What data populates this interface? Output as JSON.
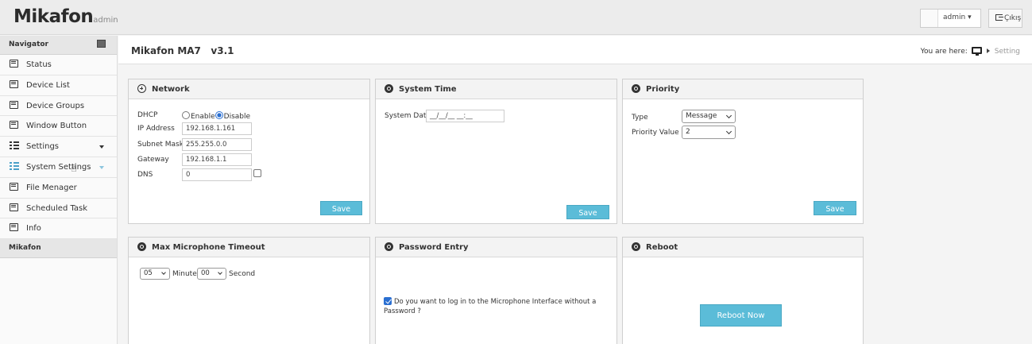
{
  "header": {
    "logo": "Mikafon",
    "logo_sub": "admin",
    "user_name": "admin",
    "exit_label": "Çıkış"
  },
  "sidebar": {
    "heading": "Navigator",
    "items": [
      {
        "label": "Status",
        "icon": "document-icon"
      },
      {
        "label": "Device List",
        "icon": "document-icon"
      },
      {
        "label": "Device Groups",
        "icon": "document-icon"
      },
      {
        "label": "Window Button",
        "icon": "document-icon"
      },
      {
        "label": "Settings",
        "icon": "list-icon"
      },
      {
        "label": "System Settings",
        "icon": "list-icon"
      },
      {
        "label": "File Menager",
        "icon": "document-icon"
      },
      {
        "label": "Scheduled Task",
        "icon": "document-icon"
      },
      {
        "label": "Info",
        "icon": "document-icon"
      }
    ],
    "group_label": "Mikafon"
  },
  "page": {
    "title": "Mikafon MA7   v3.1",
    "breadcrumb_prefix": "You are here:",
    "breadcrumb_current": "Setting"
  },
  "network": {
    "title": "Network",
    "dhcp_label": "DHCP",
    "enable_label": "Enable",
    "disable_label": "Disable",
    "dhcp_selected": "Disable",
    "ip_label": "IP Address",
    "ip_value": "192.168.1.161",
    "subnet_label": "Subnet Mask",
    "subnet_value": "255.255.0.0",
    "gateway_label": "Gateway",
    "gateway_value": "192.168.1.1",
    "dns_label": "DNS",
    "dns_value": "0",
    "save_label": "Save"
  },
  "system_time": {
    "title": "System Time",
    "date_label": "System Date",
    "date_value": "__/__/__ __:__",
    "save_label": "Save"
  },
  "priority": {
    "title": "Priority",
    "type_label": "Type",
    "type_value": "Message",
    "value_label": "Priority Value",
    "value_value": "2",
    "save_label": "Save"
  },
  "mic_timeout": {
    "title": "Max Microphone Timeout",
    "minute_value": "05",
    "minute_label": "Minute",
    "second_value": "00",
    "second_label": "Second"
  },
  "password_entry": {
    "title": "Password Entry",
    "checkbox_label": "Do you want to log in to the Microphone Interface without a Password ?",
    "checked": true
  },
  "reboot": {
    "title": "Reboot",
    "button_label": "Reboot Now"
  },
  "colors": {
    "accent": "#5bbcd8",
    "radio_checked": "#2a6fd1"
  }
}
